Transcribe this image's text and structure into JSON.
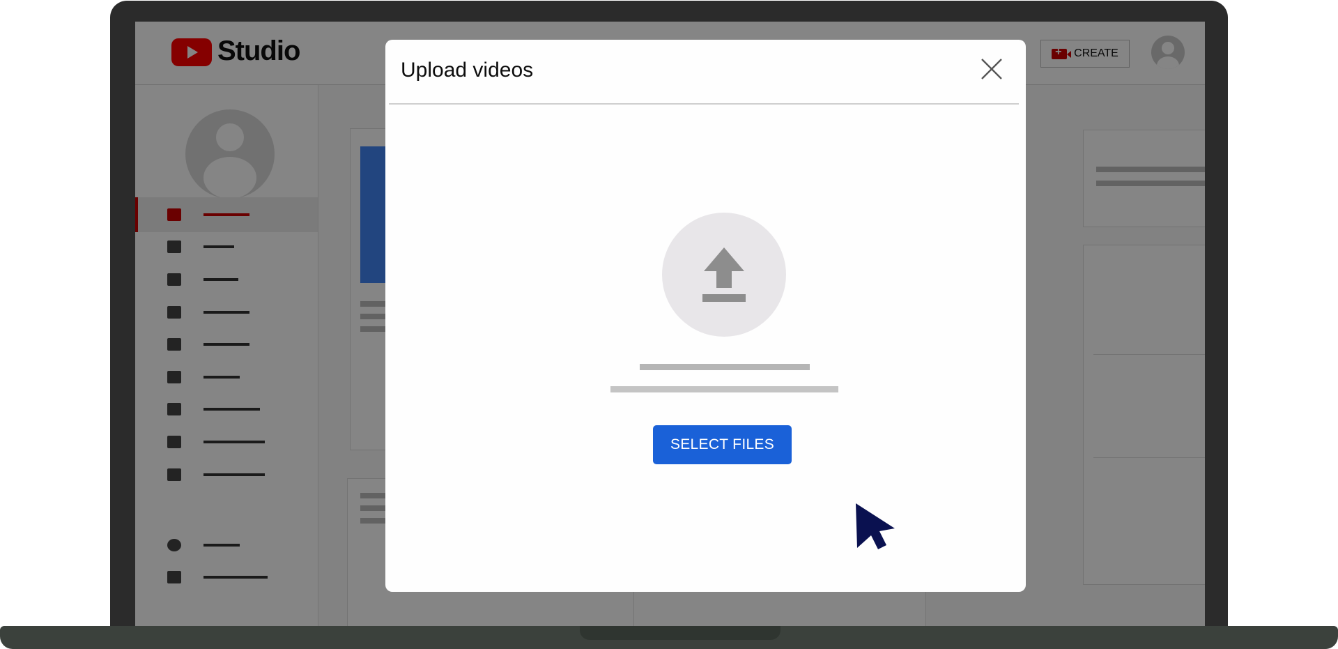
{
  "app": {
    "logo_text": "Studio",
    "create_label": "CREATE"
  },
  "modal": {
    "title": "Upload videos",
    "select_files_label": "SELECT FILES"
  },
  "icons": {
    "logo": "youtube-play-icon",
    "create": "video-camera-plus-icon",
    "account": "account-avatar-icon",
    "close": "close-icon",
    "upload": "upload-arrow-icon",
    "cursor": "mouse-pointer-icon"
  },
  "colors": {
    "brand_red": "#ff0000",
    "primary_button": "#1a61d8",
    "overlay": "rgba(0,0,0,0.48)",
    "cursor": "#0a1150"
  }
}
